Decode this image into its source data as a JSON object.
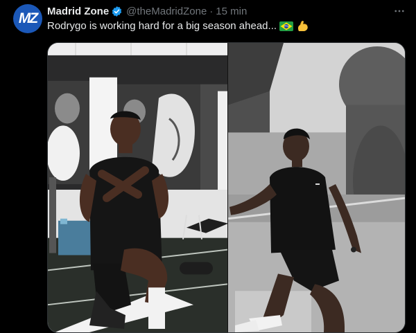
{
  "tweet": {
    "author": {
      "avatar_text": "MZ",
      "display_name": "Madrid Zone",
      "handle": "@theMadridZone",
      "verified_icon": "verified-badge-icon"
    },
    "separator": "·",
    "timestamp": "15 min",
    "text": "Rodrygo is working hard for a big season ahead...",
    "emojis": [
      "brazil-flag-icon",
      "flexed-biceps-icon"
    ],
    "more_icon": "more-options-icon",
    "media": [
      {
        "type": "photo",
        "scene": "kneeling-in-gym",
        "icon": "photo"
      },
      {
        "type": "photo",
        "scene": "kicking-outdoors",
        "icon": "photo"
      }
    ]
  },
  "colors": {
    "background": "#000000",
    "text": "#e7e9ea",
    "secondary_text": "#71767b",
    "verified": "#1d9bf0",
    "avatar_bg": "#1b58b8"
  }
}
